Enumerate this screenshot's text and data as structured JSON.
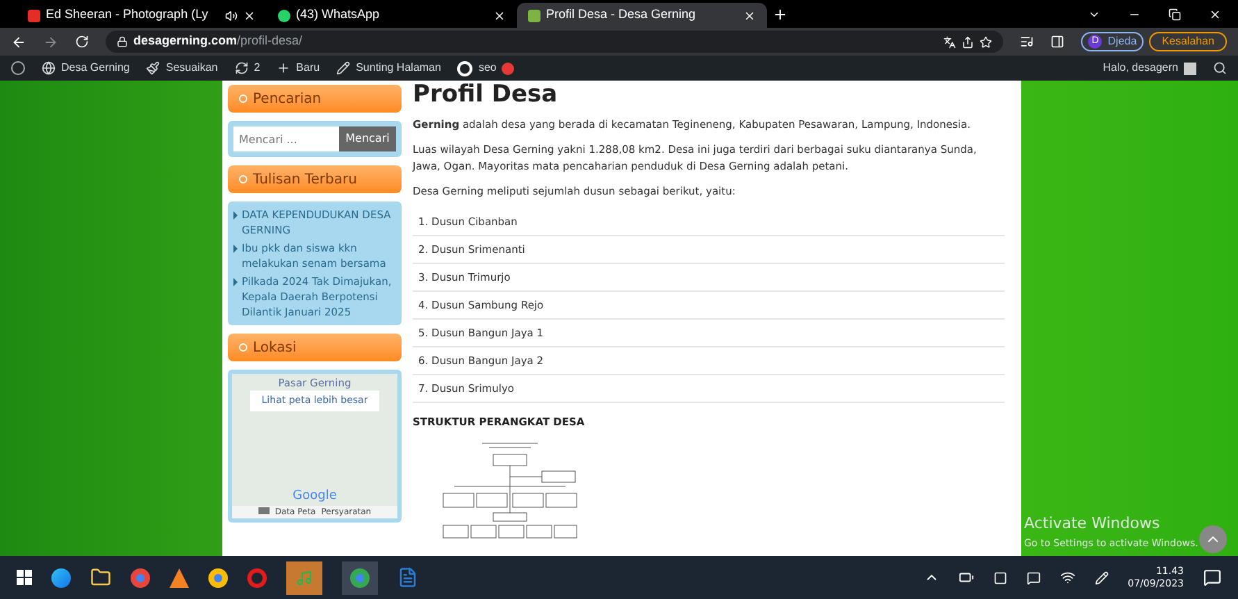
{
  "browser": {
    "tabs": [
      {
        "title": "Ed Sheeran - Photograph (Ly",
        "selected": false,
        "audio": true
      },
      {
        "title": "(43) WhatsApp",
        "selected": false,
        "audio": false
      },
      {
        "title": "Profil Desa - Desa Gerning",
        "selected": true,
        "audio": false
      }
    ],
    "url_host": "desagerning.com",
    "url_path": "/profil-desa/",
    "profile": {
      "initial": "D",
      "name": "Djeda"
    },
    "error_button": "Kesalahan"
  },
  "admin_bar": {
    "items": [
      {
        "kind": "site",
        "label": "Desa Gerning"
      },
      {
        "kind": "customize",
        "label": "Sesuaikan"
      },
      {
        "kind": "updates",
        "label": "2"
      },
      {
        "kind": "new",
        "label": "Baru"
      },
      {
        "kind": "edit",
        "label": "Sunting Halaman"
      },
      {
        "kind": "seo",
        "label": "seo"
      }
    ],
    "greeting": "Halo, desagern"
  },
  "sidebar": {
    "search_title": "Pencarian",
    "search_placeholder": "Mencari ...",
    "search_button": "Mencari",
    "recent_title": "Tulisan Terbaru",
    "recent_posts": [
      "DATA KEPENDUDUKAN DESA GERNING",
      "Ibu pkk dan siswa kkn melakukan senam bersama",
      "Pilkada 2024 Tak Dimajukan, Kepala Daerah Berpotensi Dilantik Januari 2025"
    ],
    "location_title": "Lokasi",
    "map": {
      "place": "Pasar Gerning",
      "larger_map": "Lihat peta lebih besar",
      "logo": "Google",
      "data": "Data Peta",
      "terms": "Persyaratan"
    }
  },
  "content": {
    "title": "Profil Desa",
    "paragraphs": [
      "**Gerning** adalah desa yang berada di kecamatan Tegineneng, Kabupaten Pesawaran, Lampung, Indonesia.",
      "Luas wilayah Desa Gerning yakni 1.288,08 km2. Desa ini juga terdiri dari berbagai suku diantaranya Sunda, Jawa, Ogan. Mayoritas mata pencaharian penduduk di Desa Gerning adalah petani.",
      "Desa Gerning meliputi sejumlah dusun sebagai berikut, yaitu:"
    ],
    "dusun": [
      "1. Dusun Cibanban",
      "2. Dusun Srimenanti",
      "3. Dusun Trimurjo",
      "4. Dusun Sambung Rejo",
      "5. Dusun Bangun Jaya 1",
      "6. Dusun Bangun Jaya 2",
      "7. Dusun Srimulyo"
    ],
    "structure_heading": "STRUKTUR PERANGKAT DESA"
  },
  "activation": {
    "title": "Activate Windows",
    "subtitle": "Go to Settings to activate Windows."
  },
  "taskbar": {
    "time": "11.43",
    "date": "07/09/2023"
  }
}
